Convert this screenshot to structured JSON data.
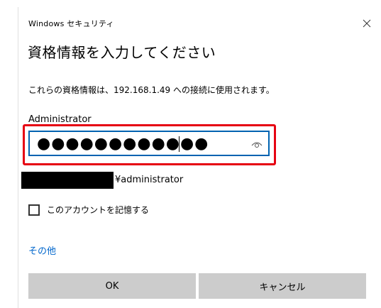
{
  "window": {
    "title": "Windows セキュリティ",
    "close_icon": "close-icon"
  },
  "dialog": {
    "heading": "資格情報を入力してください",
    "description": "これらの資格情報は、192.168.1.49 への接続に使用されます。",
    "username": "Administrator",
    "password_masked": "●●●●●●●●●●●●",
    "reveal_icon": "eye-icon",
    "domain_user": "¥administrator",
    "remember_label": "このアカウントを記憶する",
    "remember_checked": false,
    "more_choices": "その他"
  },
  "buttons": {
    "ok": "OK",
    "cancel": "キャンセル"
  },
  "colors": {
    "highlight": "#e60012",
    "focus_border": "#0063b1",
    "link": "#0066cc",
    "button_bg": "#cccccc"
  }
}
